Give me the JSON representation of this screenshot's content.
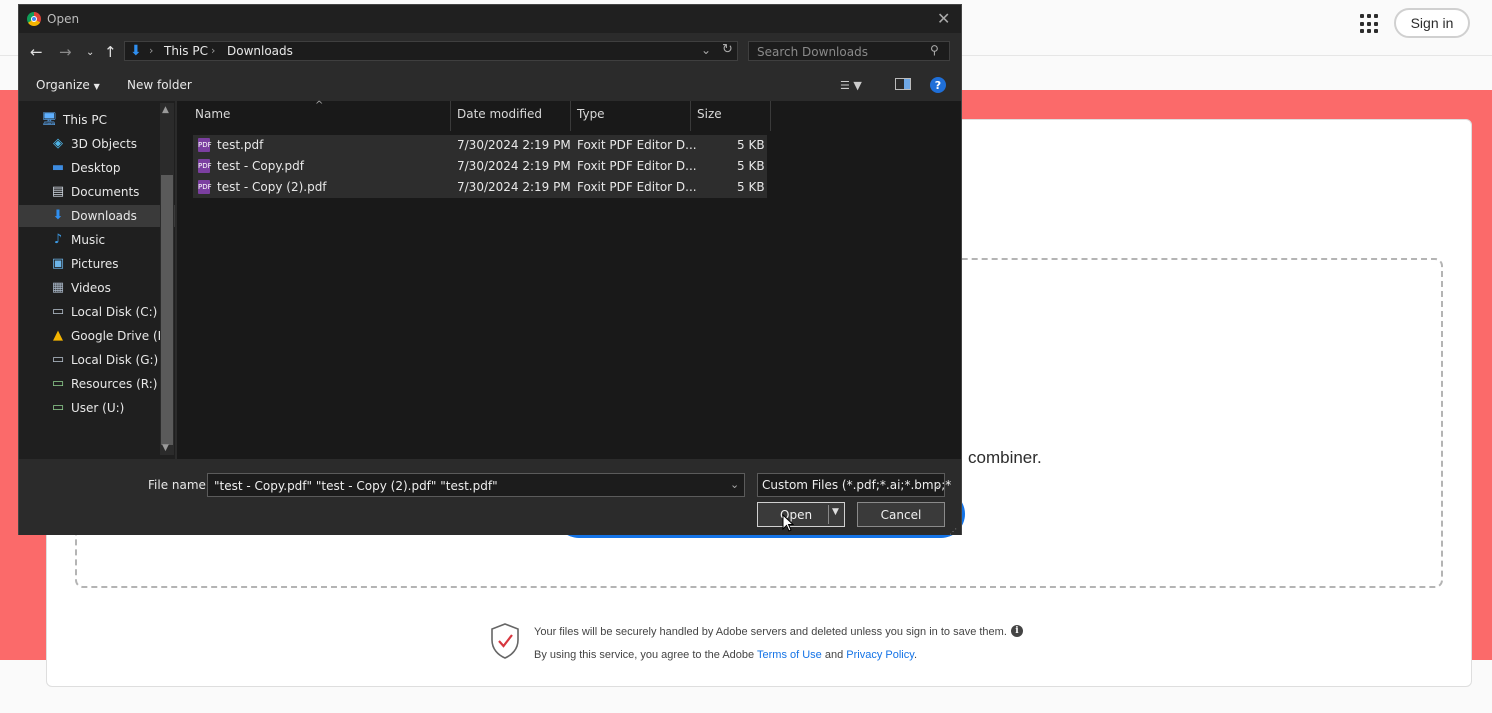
{
  "page": {
    "signin_label": "Sign in",
    "dropzone_text": "combiner.",
    "secure_text": "Your files will be securely handled by Adobe servers and deleted unless you sign in to save them.",
    "terms_prefix": "By using this service, you agree to the Adobe",
    "terms_link": "Terms of Use",
    "terms_and": "and",
    "privacy_link": "Privacy Policy",
    "terms_suffix": ".",
    "colors": {
      "band": "#fb6a6a",
      "primary_button": "#1473e6"
    }
  },
  "dialog": {
    "title": "Open",
    "breadcrumb": [
      "This PC",
      "Downloads"
    ],
    "search_placeholder": "Search Downloads",
    "toolbar": {
      "organize": "Organize",
      "new_folder": "New folder"
    },
    "tree": [
      {
        "label": "This PC",
        "icon": "computer-icon"
      },
      {
        "label": "3D Objects",
        "icon": "cube-icon"
      },
      {
        "label": "Desktop",
        "icon": "desktop-icon"
      },
      {
        "label": "Documents",
        "icon": "document-icon"
      },
      {
        "label": "Downloads",
        "icon": "download-icon",
        "selected": true
      },
      {
        "label": "Music",
        "icon": "music-icon"
      },
      {
        "label": "Pictures",
        "icon": "picture-icon"
      },
      {
        "label": "Videos",
        "icon": "video-icon"
      },
      {
        "label": "Local Disk (C:)",
        "icon": "drive-icon"
      },
      {
        "label": "Google Drive (E:)",
        "icon": "google-drive-icon"
      },
      {
        "label": "Local Disk (G:)",
        "icon": "drive-icon"
      },
      {
        "label": "Resources (R:)",
        "icon": "network-drive-icon"
      },
      {
        "label": "User (U:)",
        "icon": "network-drive-icon"
      }
    ],
    "columns": [
      "Name",
      "Date modified",
      "Type",
      "Size"
    ],
    "files": [
      {
        "name": "test.pdf",
        "date": "7/30/2024 2:19 PM",
        "type": "Foxit PDF Editor D...",
        "size": "5 KB"
      },
      {
        "name": "test - Copy.pdf",
        "date": "7/30/2024 2:19 PM",
        "type": "Foxit PDF Editor D...",
        "size": "5 KB"
      },
      {
        "name": "test - Copy (2).pdf",
        "date": "7/30/2024 2:19 PM",
        "type": "Foxit PDF Editor D...",
        "size": "5 KB"
      }
    ],
    "file_name_label": "File name:",
    "file_name_value": "\"test - Copy.pdf\" \"test - Copy (2).pdf\" \"test.pdf\"",
    "file_type": "Custom Files (*.pdf;*.ai;*.bmp;*",
    "open_label": "Open",
    "cancel_label": "Cancel"
  }
}
